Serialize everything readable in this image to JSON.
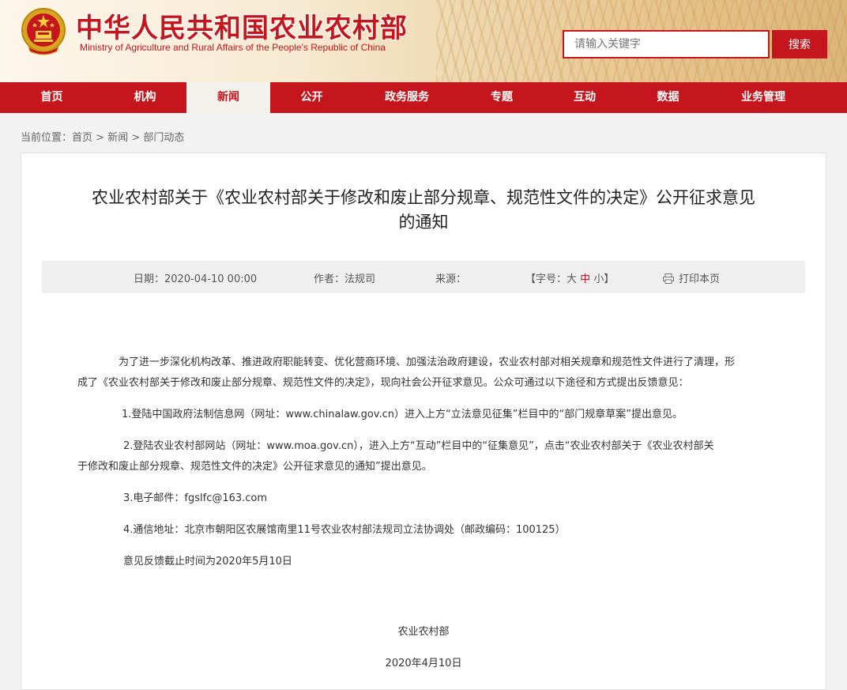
{
  "header": {
    "title": "中华人民共和国农业农村部",
    "subtitle": "Ministry of Agriculture and Rural Affairs of the People's Republic of China",
    "search_placeholder": "请输入关键字",
    "search_button": "搜索",
    "emblem_icon": "national-emblem-icon",
    "brand_color": "#c4161c"
  },
  "nav": {
    "items": [
      {
        "label": "首页"
      },
      {
        "label": "机构"
      },
      {
        "label": "新闻",
        "active": true
      },
      {
        "label": "公开"
      },
      {
        "label": "政务服务"
      },
      {
        "label": "专题"
      },
      {
        "label": "互动"
      },
      {
        "label": "数据"
      },
      {
        "label": "业务管理"
      }
    ]
  },
  "breadcrumb": {
    "prefix": "当前位置：",
    "items": [
      "首页",
      "新闻",
      "部门动态"
    ],
    "separator": " > "
  },
  "article": {
    "title_line1": "农业农村部关于《农业农村部关于修改和废止部分规章、规范性文件的决定》公开征求意见",
    "title_line2": "的通知",
    "meta": {
      "date": "日期：2020-04-10 00:00",
      "author": "作者：法规司",
      "source": "来源：",
      "font_prefix": "【字号：",
      "font_big": "大",
      "font_mid": "中",
      "font_small": "小",
      "font_suffix": "】",
      "print": "打印本页",
      "print_icon": "printer-icon"
    },
    "intro_line1": "为了进一步深化机构改革、推进政府职能转变、优化营商环境、加强法治政府建设，农业农村部对相关规章和规范性文件进行了清理，形",
    "intro_line2": "成了《农业农村部关于修改和废止部分规章、规范性文件的决定》，现向社会公开征求意见。公众可通过以下途径和方式提出反馈意见：",
    "item1": "1.登陆中国政府法制信息网（网址：www.chinalaw.gov.cn）进入上方“立法意见征集”栏目中的“部门规章草案”提出意见。",
    "item2_line1": "2.登陆农业农村部网站（网址：www.moa.gov.cn），进入上方“互动”栏目中的“征集意见”，点击“农业农村部关于《农业农村部关",
    "item2_line2": "于修改和废止部分规章、规范性文件的决定》公开征求意见的通知”提出意见。",
    "item3": "3.电子邮件：fgslfc@163.com",
    "item4": "4.通信地址：北京市朝阳区农展馆南里11号农业农村部法规司立法协调处（邮政编码：100125）",
    "deadline": "意见反馈截止时间为2020年5月10日",
    "signature": "农业农村部",
    "sign_date": "2020年4月10日"
  }
}
